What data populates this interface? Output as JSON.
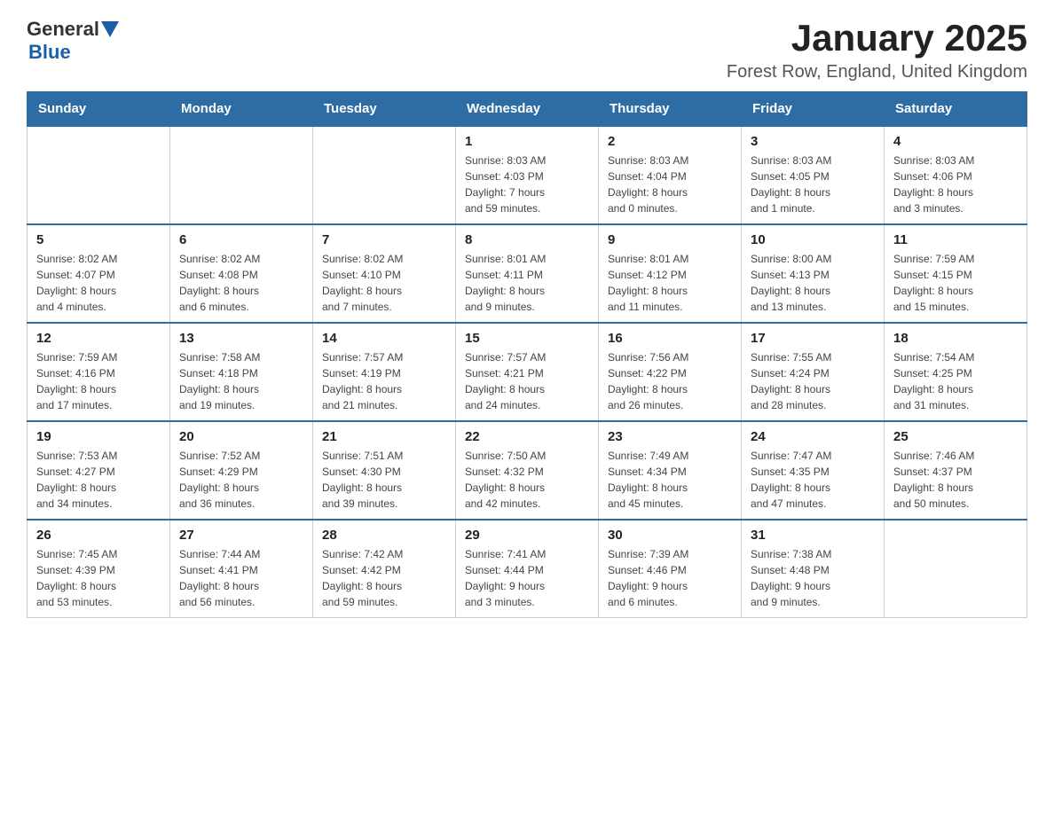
{
  "header": {
    "logo_general": "General",
    "logo_blue": "Blue",
    "title": "January 2025",
    "subtitle": "Forest Row, England, United Kingdom"
  },
  "columns": [
    "Sunday",
    "Monday",
    "Tuesday",
    "Wednesday",
    "Thursday",
    "Friday",
    "Saturday"
  ],
  "weeks": [
    [
      {
        "day": "",
        "info": ""
      },
      {
        "day": "",
        "info": ""
      },
      {
        "day": "",
        "info": ""
      },
      {
        "day": "1",
        "info": "Sunrise: 8:03 AM\nSunset: 4:03 PM\nDaylight: 7 hours\nand 59 minutes."
      },
      {
        "day": "2",
        "info": "Sunrise: 8:03 AM\nSunset: 4:04 PM\nDaylight: 8 hours\nand 0 minutes."
      },
      {
        "day": "3",
        "info": "Sunrise: 8:03 AM\nSunset: 4:05 PM\nDaylight: 8 hours\nand 1 minute."
      },
      {
        "day": "4",
        "info": "Sunrise: 8:03 AM\nSunset: 4:06 PM\nDaylight: 8 hours\nand 3 minutes."
      }
    ],
    [
      {
        "day": "5",
        "info": "Sunrise: 8:02 AM\nSunset: 4:07 PM\nDaylight: 8 hours\nand 4 minutes."
      },
      {
        "day": "6",
        "info": "Sunrise: 8:02 AM\nSunset: 4:08 PM\nDaylight: 8 hours\nand 6 minutes."
      },
      {
        "day": "7",
        "info": "Sunrise: 8:02 AM\nSunset: 4:10 PM\nDaylight: 8 hours\nand 7 minutes."
      },
      {
        "day": "8",
        "info": "Sunrise: 8:01 AM\nSunset: 4:11 PM\nDaylight: 8 hours\nand 9 minutes."
      },
      {
        "day": "9",
        "info": "Sunrise: 8:01 AM\nSunset: 4:12 PM\nDaylight: 8 hours\nand 11 minutes."
      },
      {
        "day": "10",
        "info": "Sunrise: 8:00 AM\nSunset: 4:13 PM\nDaylight: 8 hours\nand 13 minutes."
      },
      {
        "day": "11",
        "info": "Sunrise: 7:59 AM\nSunset: 4:15 PM\nDaylight: 8 hours\nand 15 minutes."
      }
    ],
    [
      {
        "day": "12",
        "info": "Sunrise: 7:59 AM\nSunset: 4:16 PM\nDaylight: 8 hours\nand 17 minutes."
      },
      {
        "day": "13",
        "info": "Sunrise: 7:58 AM\nSunset: 4:18 PM\nDaylight: 8 hours\nand 19 minutes."
      },
      {
        "day": "14",
        "info": "Sunrise: 7:57 AM\nSunset: 4:19 PM\nDaylight: 8 hours\nand 21 minutes."
      },
      {
        "day": "15",
        "info": "Sunrise: 7:57 AM\nSunset: 4:21 PM\nDaylight: 8 hours\nand 24 minutes."
      },
      {
        "day": "16",
        "info": "Sunrise: 7:56 AM\nSunset: 4:22 PM\nDaylight: 8 hours\nand 26 minutes."
      },
      {
        "day": "17",
        "info": "Sunrise: 7:55 AM\nSunset: 4:24 PM\nDaylight: 8 hours\nand 28 minutes."
      },
      {
        "day": "18",
        "info": "Sunrise: 7:54 AM\nSunset: 4:25 PM\nDaylight: 8 hours\nand 31 minutes."
      }
    ],
    [
      {
        "day": "19",
        "info": "Sunrise: 7:53 AM\nSunset: 4:27 PM\nDaylight: 8 hours\nand 34 minutes."
      },
      {
        "day": "20",
        "info": "Sunrise: 7:52 AM\nSunset: 4:29 PM\nDaylight: 8 hours\nand 36 minutes."
      },
      {
        "day": "21",
        "info": "Sunrise: 7:51 AM\nSunset: 4:30 PM\nDaylight: 8 hours\nand 39 minutes."
      },
      {
        "day": "22",
        "info": "Sunrise: 7:50 AM\nSunset: 4:32 PM\nDaylight: 8 hours\nand 42 minutes."
      },
      {
        "day": "23",
        "info": "Sunrise: 7:49 AM\nSunset: 4:34 PM\nDaylight: 8 hours\nand 45 minutes."
      },
      {
        "day": "24",
        "info": "Sunrise: 7:47 AM\nSunset: 4:35 PM\nDaylight: 8 hours\nand 47 minutes."
      },
      {
        "day": "25",
        "info": "Sunrise: 7:46 AM\nSunset: 4:37 PM\nDaylight: 8 hours\nand 50 minutes."
      }
    ],
    [
      {
        "day": "26",
        "info": "Sunrise: 7:45 AM\nSunset: 4:39 PM\nDaylight: 8 hours\nand 53 minutes."
      },
      {
        "day": "27",
        "info": "Sunrise: 7:44 AM\nSunset: 4:41 PM\nDaylight: 8 hours\nand 56 minutes."
      },
      {
        "day": "28",
        "info": "Sunrise: 7:42 AM\nSunset: 4:42 PM\nDaylight: 8 hours\nand 59 minutes."
      },
      {
        "day": "29",
        "info": "Sunrise: 7:41 AM\nSunset: 4:44 PM\nDaylight: 9 hours\nand 3 minutes."
      },
      {
        "day": "30",
        "info": "Sunrise: 7:39 AM\nSunset: 4:46 PM\nDaylight: 9 hours\nand 6 minutes."
      },
      {
        "day": "31",
        "info": "Sunrise: 7:38 AM\nSunset: 4:48 PM\nDaylight: 9 hours\nand 9 minutes."
      },
      {
        "day": "",
        "info": ""
      }
    ]
  ]
}
